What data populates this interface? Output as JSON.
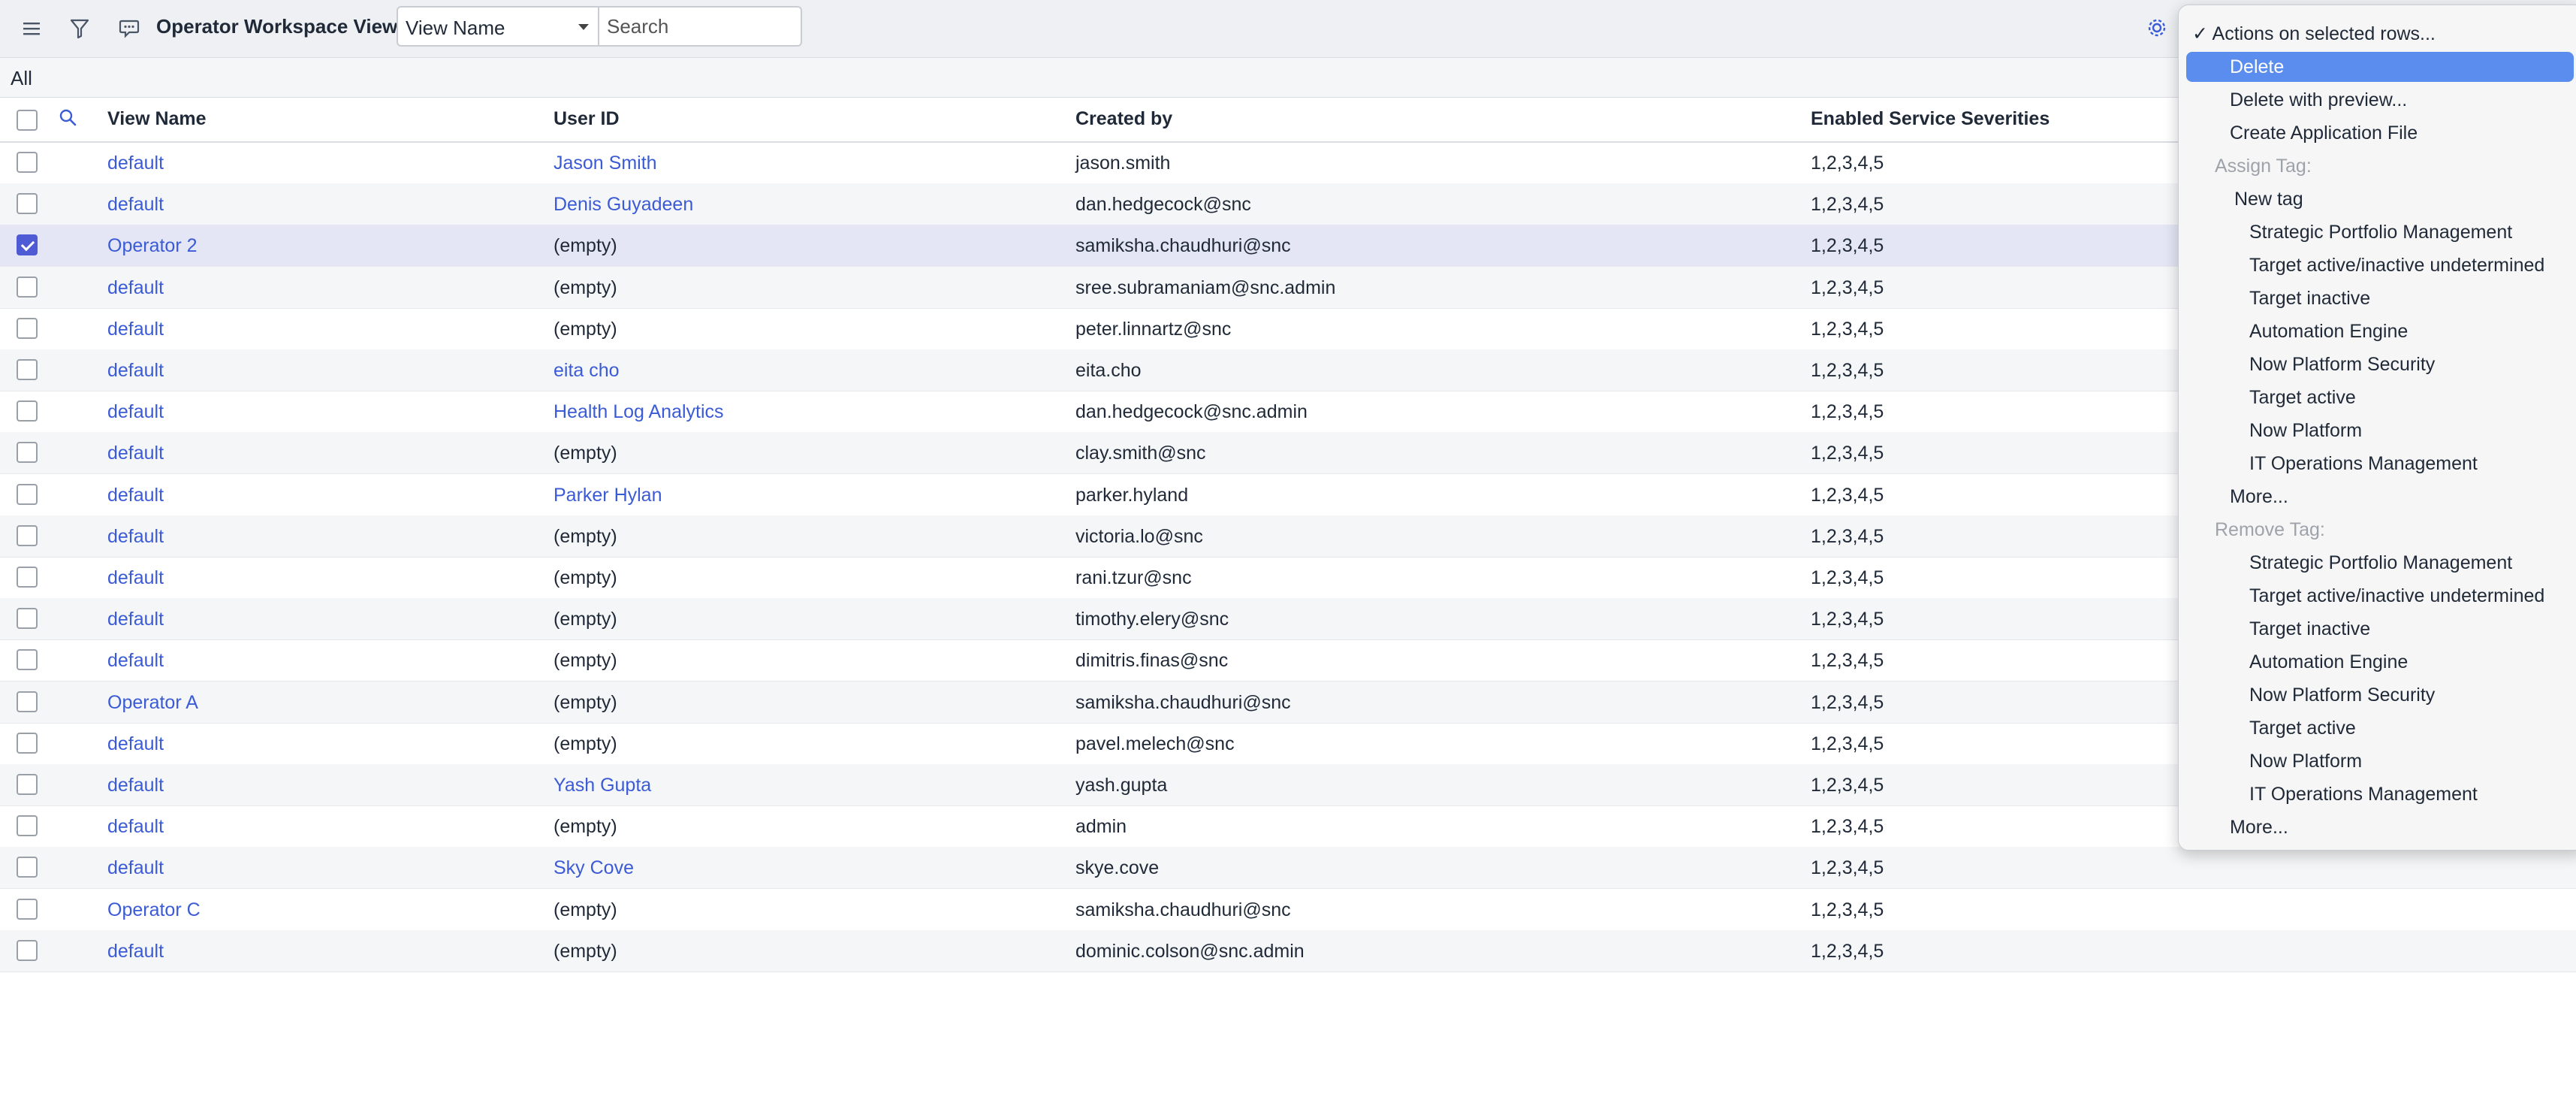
{
  "header": {
    "title": "Operator Workspace Views",
    "field_select": "View Name",
    "search_placeholder": "Search"
  },
  "breadcrumb": "All",
  "table": {
    "columns": [
      "View Name",
      "User ID",
      "Created by",
      "Enabled Service Severities"
    ],
    "rows": [
      {
        "view": "default",
        "user": "Jason Smith",
        "created_by": "jason.smith",
        "severities": "1,2,3,4,5",
        "checked": false
      },
      {
        "view": "default",
        "user": "Denis Guyadeen",
        "created_by": "dan.hedgecock@snc",
        "severities": "1,2,3,4,5",
        "checked": false
      },
      {
        "view": "Operator 2",
        "user": "(empty)",
        "created_by": "samiksha.chaudhuri@snc",
        "severities": "1,2,3,4,5",
        "checked": true
      },
      {
        "view": "default",
        "user": "(empty)",
        "created_by": "sree.subramaniam@snc.admin",
        "severities": "1,2,3,4,5",
        "checked": false
      },
      {
        "view": "default",
        "user": "(empty)",
        "created_by": "peter.linnartz@snc",
        "severities": "1,2,3,4,5",
        "checked": false
      },
      {
        "view": "default",
        "user": "eita cho",
        "created_by": "eita.cho",
        "severities": "1,2,3,4,5",
        "checked": false
      },
      {
        "view": "default",
        "user": "Health Log Analytics",
        "created_by": "dan.hedgecock@snc.admin",
        "severities": "1,2,3,4,5",
        "checked": false
      },
      {
        "view": "default",
        "user": "(empty)",
        "created_by": "clay.smith@snc",
        "severities": "1,2,3,4,5",
        "checked": false
      },
      {
        "view": "default",
        "user": "Parker Hylan",
        "created_by": "parker.hyland",
        "severities": "1,2,3,4,5",
        "checked": false
      },
      {
        "view": "default",
        "user": "(empty)",
        "created_by": "victoria.lo@snc",
        "severities": "1,2,3,4,5",
        "checked": false
      },
      {
        "view": "default",
        "user": "(empty)",
        "created_by": "rani.tzur@snc",
        "severities": "1,2,3,4,5",
        "checked": false
      },
      {
        "view": "default",
        "user": "(empty)",
        "created_by": "timothy.elery@snc",
        "severities": "1,2,3,4,5",
        "checked": false
      },
      {
        "view": "default",
        "user": "(empty)",
        "created_by": "dimitris.finas@snc",
        "severities": "1,2,3,4,5",
        "checked": false
      },
      {
        "view": "Operator A",
        "user": "(empty)",
        "created_by": "samiksha.chaudhuri@snc",
        "severities": "1,2,3,4,5",
        "checked": false
      },
      {
        "view": "default",
        "user": "(empty)",
        "created_by": "pavel.melech@snc",
        "severities": "1,2,3,4,5",
        "checked": false
      },
      {
        "view": "default",
        "user": "Yash Gupta",
        "created_by": "yash.gupta",
        "severities": "1,2,3,4,5",
        "checked": false
      },
      {
        "view": "default",
        "user": "(empty)",
        "created_by": "admin",
        "severities": "1,2,3,4,5",
        "checked": false
      },
      {
        "view": "default",
        "user": "Sky Cove",
        "created_by": "skye.cove",
        "severities": "1,2,3,4,5",
        "checked": false
      },
      {
        "view": "Operator C",
        "user": "(empty)",
        "created_by": "samiksha.chaudhuri@snc",
        "severities": "1,2,3,4,5",
        "checked": false
      },
      {
        "view": "default",
        "user": "(empty)",
        "created_by": "dominic.colson@snc.admin",
        "severities": "1,2,3,4,5",
        "checked": false
      }
    ]
  },
  "menu": {
    "items": [
      {
        "label": "✓ Actions on selected rows...",
        "kind": "heading"
      },
      {
        "label": "Delete",
        "kind": "highlight"
      },
      {
        "label": "Delete with preview...",
        "kind": "item"
      },
      {
        "label": "Create Application File",
        "kind": "item"
      },
      {
        "label": "Assign Tag:",
        "kind": "disabled"
      },
      {
        "label": "New tag",
        "kind": "sub"
      },
      {
        "label": "Strategic Portfolio Management",
        "kind": "tag"
      },
      {
        "label": "Target active/inactive undetermined",
        "kind": "tag"
      },
      {
        "label": "Target inactive",
        "kind": "tag"
      },
      {
        "label": "Automation Engine",
        "kind": "tag"
      },
      {
        "label": "Now Platform Security",
        "kind": "tag"
      },
      {
        "label": "Target active",
        "kind": "tag"
      },
      {
        "label": "Now Platform",
        "kind": "tag"
      },
      {
        "label": "IT Operations Management",
        "kind": "tag"
      },
      {
        "label": "More...",
        "kind": "item"
      },
      {
        "label": "Remove Tag:",
        "kind": "disabled"
      },
      {
        "label": "Strategic Portfolio Management",
        "kind": "tag"
      },
      {
        "label": "Target active/inactive undetermined",
        "kind": "tag"
      },
      {
        "label": "Target inactive",
        "kind": "tag"
      },
      {
        "label": "Automation Engine",
        "kind": "tag"
      },
      {
        "label": "Now Platform Security",
        "kind": "tag"
      },
      {
        "label": "Target active",
        "kind": "tag"
      },
      {
        "label": "Now Platform",
        "kind": "tag"
      },
      {
        "label": "IT Operations Management",
        "kind": "tag"
      },
      {
        "label": "More...",
        "kind": "item"
      }
    ]
  },
  "icons": {
    "menu": "hamburger-icon",
    "filter": "funnel-icon",
    "chat": "comment-icon",
    "settings": "gear-icon",
    "search_column": "search-icon"
  },
  "colors": {
    "link": "#3b5bd6",
    "checkbox": "#4f5bd5",
    "menu_highlight": "#5b8def"
  }
}
